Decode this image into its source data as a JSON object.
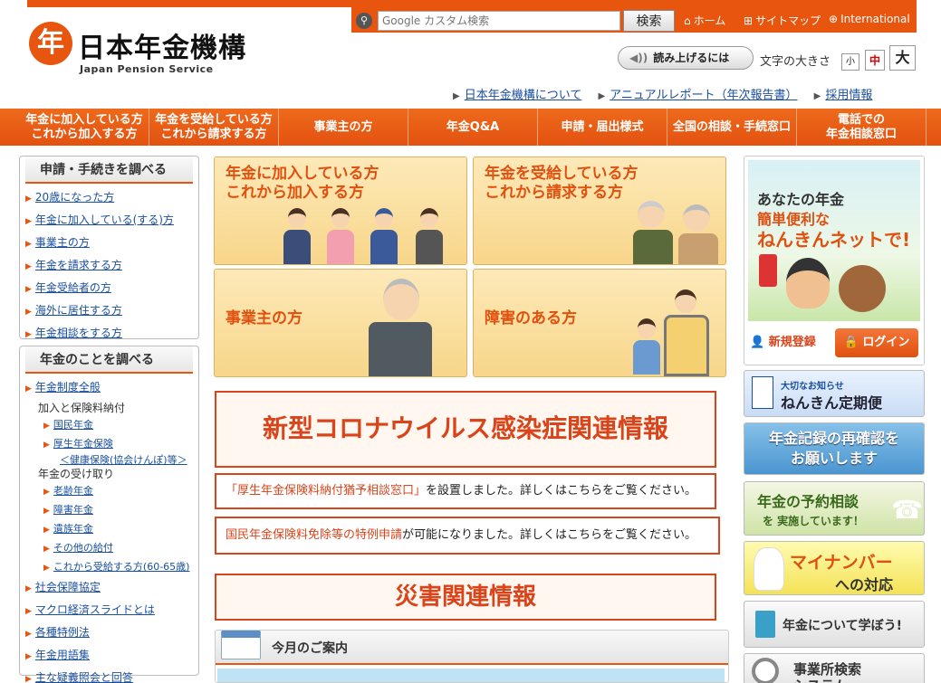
{
  "header": {
    "logo_mark": "年",
    "logo_ja": "日本年金機構",
    "logo_en": "Japan Pension Service",
    "search": {
      "placeholder": "Google カスタム検索",
      "button": "検索"
    },
    "util_links": [
      {
        "icon": "home-icon",
        "glyph": "⌂",
        "label": "ホーム"
      },
      {
        "icon": "sitemap-icon",
        "glyph": "⊞",
        "label": "サイトマップ"
      },
      {
        "icon": "globe-icon",
        "glyph": "⊕",
        "label": "International"
      }
    ],
    "read_aloud": "読み上げるには",
    "font_size_label": "文字の大きさ",
    "font_sizes": [
      "小",
      "中",
      "大"
    ],
    "font_size_selected": "中",
    "sub_links": [
      "日本年金機構について",
      "アニュアルレポート（年次報告書）",
      "採用情報"
    ]
  },
  "gnav": [
    "年金に加入している方\nこれから加入する方",
    "年金を受給している方\nこれから請求する方",
    "事業主の方",
    "年金Q&A",
    "申請・届出様式",
    "全国の相談・手続窓口",
    "電話での\n年金相談窓口"
  ],
  "sidebar": {
    "box1": {
      "title": "申請・手続きを調べる",
      "items": [
        "20歳になった方",
        "年金に加入している(する)方",
        "事業主の方",
        "年金を請求する方",
        "年金受給者の方",
        "海外に居住する方",
        "年金相談をする方"
      ]
    },
    "box2": {
      "title": "年金のことを調べる",
      "item_top": "年金制度全般",
      "plain1": "加入と保険料納付",
      "sub1": [
        "国民年金",
        "厚生年金保険"
      ],
      "sub1_extra": "＜健康保険(協会けんぽ)等＞",
      "plain2": "年金の受け取り",
      "sub2": [
        "老齢年金",
        "障害年金",
        "遺族年金",
        "その他の給付",
        "これから受給する方(60-65歳)"
      ],
      "items": [
        "社会保障協定",
        "マクロ経済スライドとは",
        "各種特例法",
        "年金用語集",
        "主な疑義照会と回答"
      ]
    }
  },
  "tiles": [
    "年金に加入している方\nこれから加入する方",
    "年金を受給している方\nこれから請求する方",
    "事業主の方",
    "障害のある方"
  ],
  "notices": {
    "corona": "新型コロナウイルス感染症関連情報",
    "news1_link": "「厚生年金保険料納付猶予相談窓口」",
    "news1_text": "を設置しました。詳しくはこちらをご覧ください。",
    "news2_link": "国民年金保険料免除等の特例申請",
    "news2_text": "が可能になりました。詳しくはこちらをご覧ください。",
    "disaster": "災害関連情報",
    "monthly": "今月のご案内"
  },
  "right": {
    "nenkin_net": {
      "line1": "あなたの年金",
      "line2": "簡単便利な",
      "line3": "ねんきんネットで!",
      "signup": "新規登録",
      "login": "ログイン"
    },
    "teiki_small": "大切なお知らせ",
    "teiki_big": "ねんきん定期便",
    "kiroku": "年金記録の再確認を\nお願いします",
    "yoyaku_l1": "年金の予約相談",
    "yoyaku_l2": "を 実施しています！",
    "mynumber_l1": "マイナンバー",
    "mynumber_l2": "への対応",
    "manabo": "年金について学ぼう!",
    "jigyosho": "事業所検索\nシステム"
  },
  "colors": {
    "brand_orange": "#e8550f",
    "link_blue": "#1a4fa0",
    "alert_red": "#d9441a"
  }
}
